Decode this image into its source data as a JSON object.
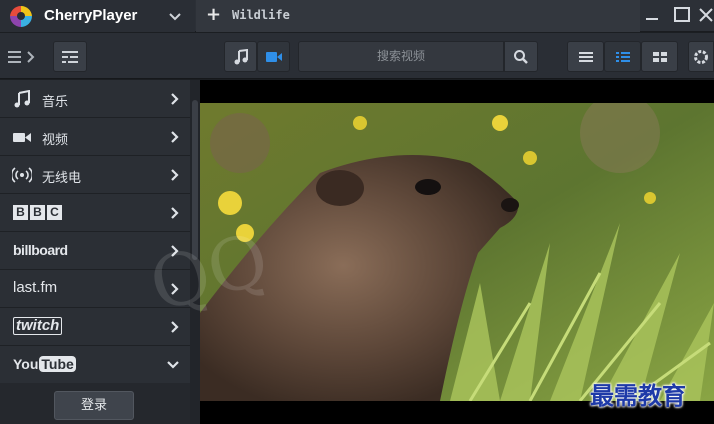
{
  "app": {
    "name": "CherryPlayer"
  },
  "tab": {
    "plus": "+",
    "label": "Wildlife"
  },
  "toolbar": {
    "search_placeholder": "搜索视频"
  },
  "sidebar": {
    "items": [
      {
        "label": "音乐",
        "icon": "music-note-icon"
      },
      {
        "label": "视频",
        "icon": "video-camera-icon"
      },
      {
        "label": "无线电",
        "icon": "radio-icon"
      },
      {
        "label": "BBC",
        "icon": "bbc-logo"
      },
      {
        "label": "billboard",
        "icon": "billboard-logo"
      },
      {
        "label": "last.fm",
        "icon": "lastfm-logo"
      },
      {
        "label": "twitch",
        "icon": "twitch-logo"
      },
      {
        "label": "YouTube",
        "icon": "youtube-logo"
      }
    ],
    "login": "登录"
  },
  "watermark": "最需教育",
  "colors": {
    "accent": "#2f8fe8",
    "background": "#1b1e22",
    "panel": "#2b2f35"
  }
}
